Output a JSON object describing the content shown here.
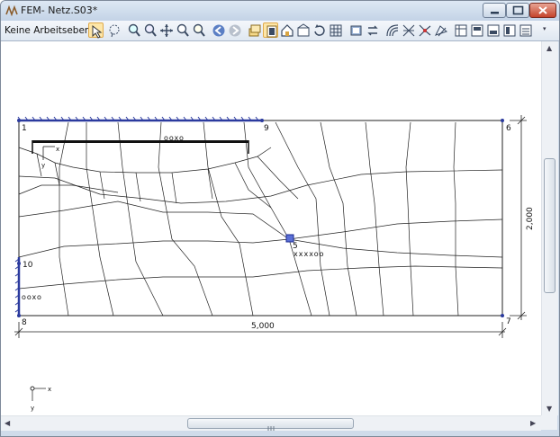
{
  "window": {
    "title": "FEM- Netz.S03*",
    "caption_buttons": [
      "minimize",
      "maximize",
      "close"
    ]
  },
  "toolbar": {
    "layer_dropdown": "Keine Arbeitseben",
    "icons": [
      "select-arrow-icon",
      "lasso-icon",
      "zoom-in-icon",
      "zoom-icon",
      "pan-icon",
      "zoom-out-icon",
      "zoom-all-icon",
      "back-icon",
      "forward-icon",
      "layers-icon",
      "page-icon",
      "home-icon",
      "view-icon",
      "rotate-icon",
      "grid-icon",
      "render-icon",
      "swap-icon",
      "contour-icon",
      "mesh-icon",
      "node-icon",
      "element-icon",
      "table-icon",
      "panel-1-icon",
      "panel-2-icon",
      "panel-3-icon",
      "panel-4-icon"
    ]
  },
  "drawing": {
    "nodes": [
      "1",
      "9",
      "6",
      "10",
      "8",
      "7",
      "5"
    ],
    "node_values": {
      "top": "ooxo",
      "middle": "xxxxoo",
      "left": "ooxo"
    },
    "dimensions": {
      "width": "5,000",
      "height": "2,000"
    },
    "axes": {
      "x": "x",
      "y": "y"
    }
  }
}
